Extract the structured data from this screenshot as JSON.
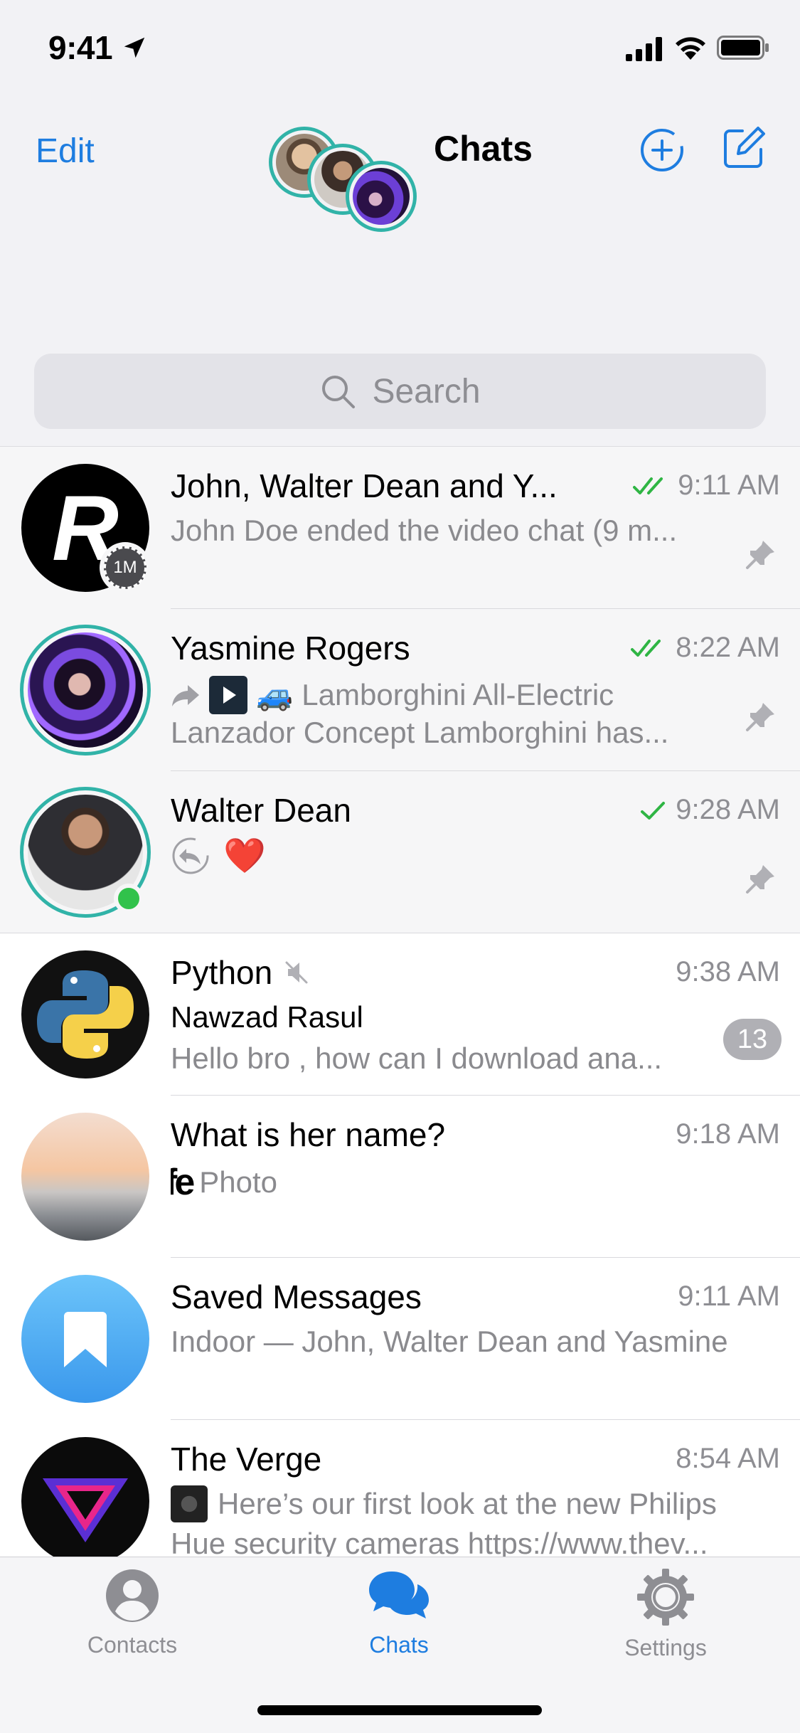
{
  "status_bar": {
    "time": "9:41"
  },
  "header": {
    "edit_label": "Edit",
    "title": "Chats",
    "icons": [
      "plus-circle-icon",
      "compose-icon"
    ]
  },
  "search": {
    "placeholder": "Search"
  },
  "chats": [
    {
      "name": "John, Walter Dean and Y...",
      "time": "9:11 AM",
      "status": "read",
      "line1": "John Doe ended the video chat (9 m...",
      "pinned": true,
      "avatar_text": "R",
      "avatar_badge": "1M"
    },
    {
      "name": "Yasmine Rogers",
      "time": "8:22 AM",
      "status": "read",
      "line1": "Lamborghini All-Electric",
      "line2": "Lanzador Concept Lamborghini has...",
      "pinned": true
    },
    {
      "name": "Walter Dean",
      "time": "9:28 AM",
      "status": "sent",
      "line1": "❤️",
      "pinned": true,
      "online": true
    },
    {
      "name": "Python",
      "muted": true,
      "time": "9:38 AM",
      "sender": "Nawzad Rasul",
      "line1": "Hello bro , how can I download ana...",
      "unread": "13"
    },
    {
      "name": "What is her name?",
      "time": "9:18 AM",
      "line1": "Photo",
      "thumb_text": "fe"
    },
    {
      "name": "Saved Messages",
      "time": "9:11 AM",
      "line1": "Indoor — John, Walter Dean and Yasmine"
    },
    {
      "name": "The Verge",
      "time": "8:54 AM",
      "line1": "Here’s our first look at the new Philips",
      "line2": "Hue security cameras https://www.thev..."
    }
  ],
  "tabs": [
    {
      "label": "Contacts",
      "icon": "person-icon",
      "active": false
    },
    {
      "label": "Chats",
      "icon": "chat-bubbles-icon",
      "active": true
    },
    {
      "label": "Settings",
      "icon": "gear-icon",
      "active": false
    }
  ],
  "colors": {
    "accent": "#1e7de0",
    "read_check": "#2fb544",
    "online": "#31c24b",
    "story_ring": "#31b3a8"
  }
}
